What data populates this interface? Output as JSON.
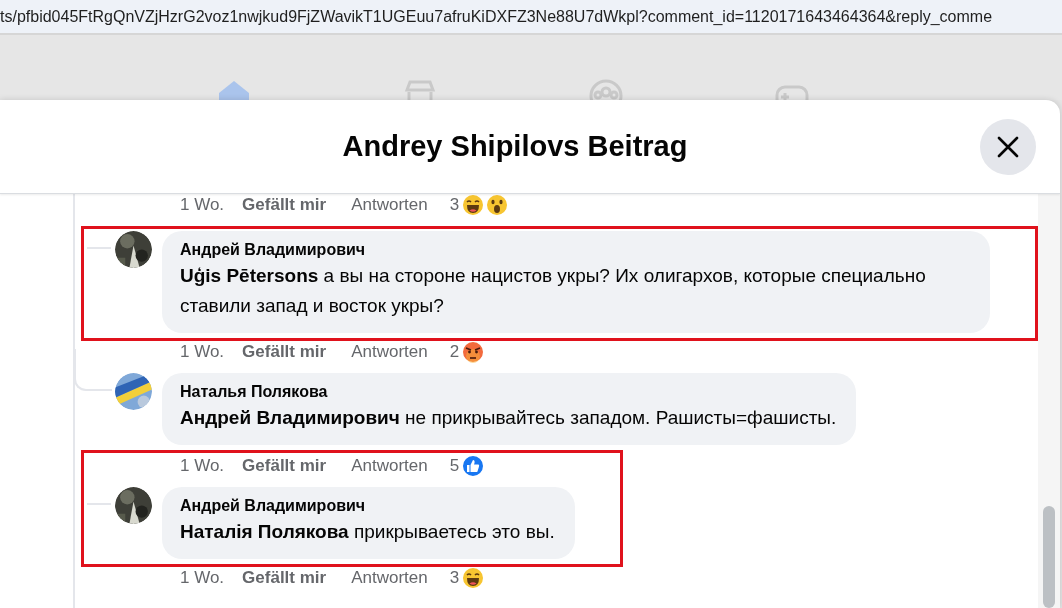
{
  "address_bar": {
    "url": "ts/pfbid045FtRgQnVZjHzrG2voz1nwjkud9FjZWavikT1UGEuu7afruKiDXFZ3Ne88U7dWkpl?comment_id=1120171643464364&reply_comme"
  },
  "dialog": {
    "title": "Andrey Shipilovs Beitrag",
    "blocks": [
      {
        "kind": "actions",
        "time": "1 Wo.",
        "like": "Gefällt mir",
        "reply": "Antworten",
        "count": "3",
        "reactions": [
          {
            "kind": "haha"
          },
          {
            "kind": "wow"
          }
        ]
      },
      {
        "kind": "highlight",
        "items": [
          {
            "kind": "comment",
            "author": "Андрей Владимирович",
            "text": "**Uģis Pētersons** а вы на стороне нацистов укры? Их олигархов, которые специально ставили запад и восток укры?"
          }
        ]
      },
      {
        "kind": "actions",
        "time": "1 Wo.",
        "like": "Gefällt mir",
        "reply": "Antworten",
        "count": "2",
        "reactions": [
          {
            "kind": "angry"
          }
        ]
      },
      {
        "kind": "comment",
        "author": "Наталья Полякова",
        "text": "**Андрей Владимирович** не прикрывайтесь западом. Рашисты=фашисты."
      },
      {
        "kind": "highlight",
        "items": [
          {
            "kind": "actions",
            "time": "1 Wo.",
            "like": "Gefällt mir",
            "reply": "Antworten",
            "count": "5",
            "reactions": [
              {
                "kind": "like"
              }
            ]
          },
          {
            "kind": "comment",
            "author": "Андрей Владимирович",
            "text": "**Наталія Полякова** прикрываетесь это вы."
          }
        ]
      },
      {
        "kind": "actions",
        "time": "1 Wo.",
        "like": "Gefällt mir",
        "reply": "Antworten",
        "count": "3",
        "reactions": [
          {
            "kind": "haha"
          }
        ]
      }
    ]
  }
}
